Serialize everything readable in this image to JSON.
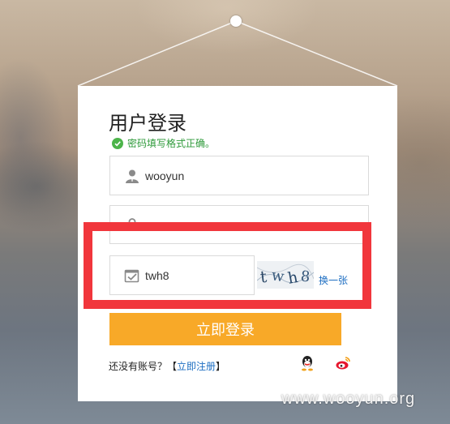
{
  "login": {
    "title": "用户登录",
    "status_message": "密码填写格式正确。",
    "username_value": "wooyun",
    "password_value": "",
    "captcha_value": "twh8",
    "captcha_image_text": "twh8",
    "swap_captcha_label": "换一张",
    "submit_label": "立即登录",
    "no_account_text": "还没有账号？",
    "bracket_open": "【",
    "register_link_label": "立即注册",
    "bracket_close": "】",
    "social": {
      "qq_icon": "qq-penguin-icon",
      "weibo_icon": "weibo-icon"
    }
  },
  "watermark": "www.wooyun.org",
  "colors": {
    "accent_button": "#f8a928",
    "link": "#1d6ec2",
    "success": "#2e9a3a",
    "highlight": "#f1363c"
  }
}
